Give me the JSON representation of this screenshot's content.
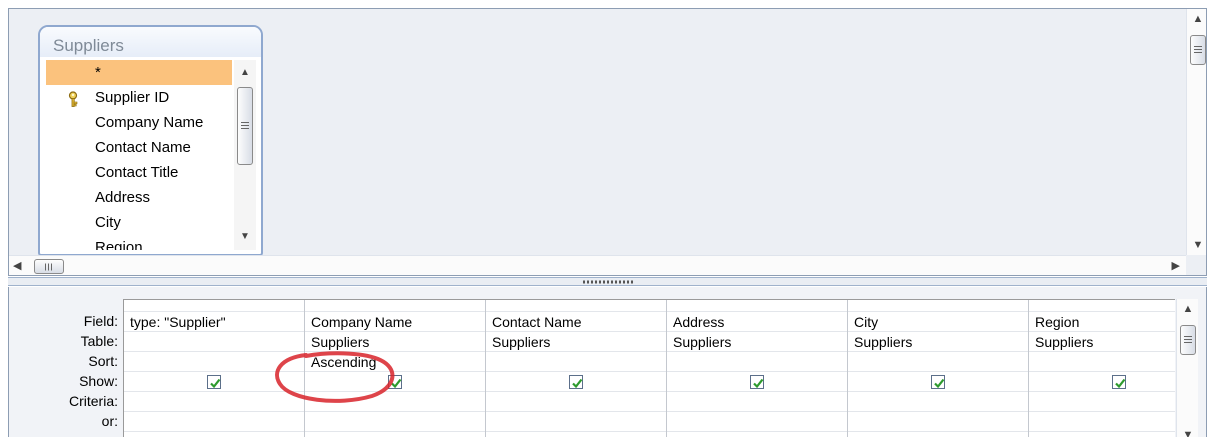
{
  "table": {
    "title": "Suppliers",
    "fields": [
      "*",
      "Supplier ID",
      "Company Name",
      "Contact Name",
      "Contact Title",
      "Address",
      "City",
      "Region"
    ],
    "primary_key_field": "Supplier ID",
    "key_icon": "key-icon"
  },
  "grid": {
    "row_labels": [
      "Field:",
      "Table:",
      "Sort:",
      "Show:",
      "Criteria:",
      "or:"
    ],
    "columns": [
      {
        "field": "type: \"Supplier\"",
        "table": "",
        "sort": "",
        "show": true
      },
      {
        "field": "Company Name",
        "table": "Suppliers",
        "sort": "Ascending",
        "show": true
      },
      {
        "field": "Contact Name",
        "table": "Suppliers",
        "sort": "",
        "show": true
      },
      {
        "field": "Address",
        "table": "Suppliers",
        "sort": "",
        "show": true
      },
      {
        "field": "City",
        "table": "Suppliers",
        "sort": "",
        "show": true
      },
      {
        "field": "Region",
        "table": "Suppliers",
        "sort": "",
        "show": true
      }
    ]
  },
  "colors": {
    "selected_field": "#fbc27d",
    "annotation": "#d8232a",
    "check": "#2e9b2e"
  }
}
